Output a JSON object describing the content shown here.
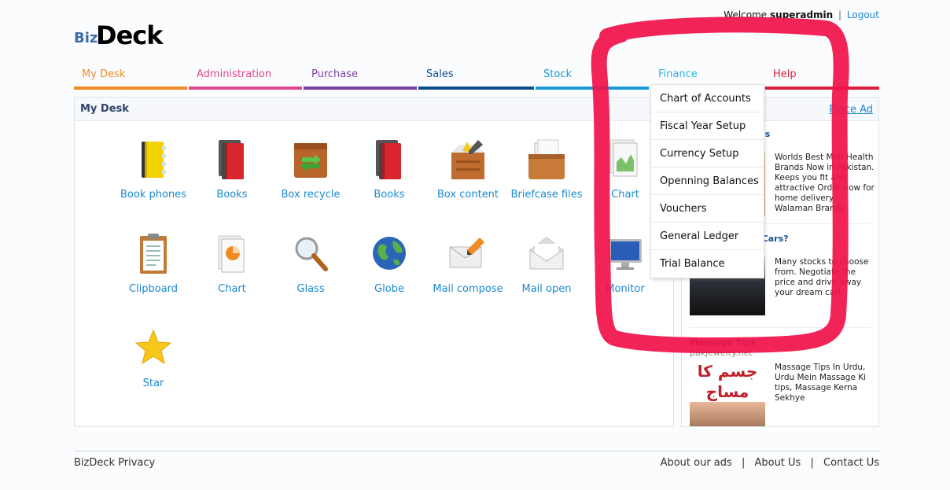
{
  "header": {
    "welcome_prefix": "Welcome",
    "username": "superadmin",
    "separator": "|",
    "logout_label": "Logout"
  },
  "logo": {
    "biz": "Biz",
    "deck": "Deck"
  },
  "nav": {
    "items": [
      {
        "label": "My Desk",
        "color": "#f08a24"
      },
      {
        "label": "Administration",
        "color": "#e0468e"
      },
      {
        "label": "Purchase",
        "color": "#7a3fa0"
      },
      {
        "label": "Sales",
        "color": "#0f4c8a"
      },
      {
        "label": "Stock",
        "color": "#1a9ad6"
      },
      {
        "label": "Finance",
        "color": "#2bb3d8"
      },
      {
        "label": "Help",
        "color": "#d81f3c"
      }
    ]
  },
  "mydesk": {
    "title": "My Desk",
    "icons": [
      {
        "label": "Book phones",
        "icon": "book-phones-icon"
      },
      {
        "label": "Books",
        "icon": "books-icon"
      },
      {
        "label": "Box recycle",
        "icon": "box-recycle-icon"
      },
      {
        "label": "Books",
        "icon": "books-icon"
      },
      {
        "label": "Box content",
        "icon": "box-content-icon"
      },
      {
        "label": "Briefcase files",
        "icon": "briefcase-icon"
      },
      {
        "label": "Chart",
        "icon": "chart-icon"
      },
      {
        "label": "Clipboard",
        "icon": "clipboard-icon"
      },
      {
        "label": "Chart",
        "icon": "chart-icon"
      },
      {
        "label": "Glass",
        "icon": "magnifier-icon"
      },
      {
        "label": "Globe",
        "icon": "globe-icon"
      },
      {
        "label": "Mail compose",
        "icon": "mail-compose-icon"
      },
      {
        "label": "Mail open",
        "icon": "mail-open-icon"
      },
      {
        "label": "Monitor",
        "icon": "monitor-icon"
      },
      {
        "label": "Star",
        "icon": "star-icon"
      }
    ]
  },
  "ads": {
    "place_ad_label": "Place Ad",
    "ad1_title": "ls",
    "ad1_text": "Worlds Best Men Health Brands Now in Pakistan. Keeps you fit and attractive Order now for home delivery. Walaman Brands",
    "ad2_title": "n Cars?",
    "ad2_text": "Many stocks to choose from. Negotiate the price and drive away your dream car!",
    "ad3_title": "Massage Tips",
    "ad3_url": "pakjewelry.net",
    "ad3_text": "Massage Tips In Urdu, Urdu Mein Massage Ki tips, Massage Kerna Sekhye",
    "ad3_urdu": "جسم کا مساج"
  },
  "finance_menu": {
    "items": [
      "Chart of Accounts",
      "Fiscal Year Setup",
      "Currency Setup",
      "Openning Balances",
      "Vouchers",
      "General Ledger",
      "Trial Balance"
    ]
  },
  "footer": {
    "privacy": "BizDeck Privacy",
    "about_ads": "About our ads",
    "about_us": "About Us",
    "contact_us": "Contact Us",
    "separator": "|"
  },
  "colors": {
    "link": "#1a8ad0",
    "annotation": "#f0124a"
  }
}
